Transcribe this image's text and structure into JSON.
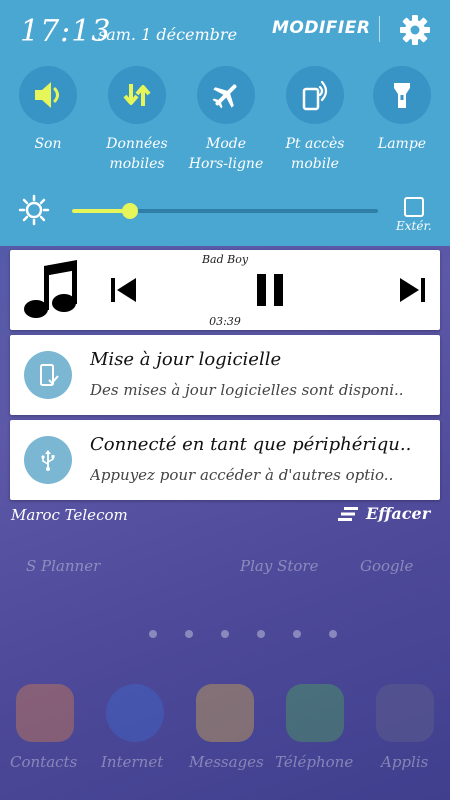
{
  "status": {
    "time": "17:13",
    "date": "sam. 1 décembre",
    "modify_label": "MODIFIER"
  },
  "quick_settings": [
    {
      "label_line1": "Son",
      "label_line2": "",
      "icon": "speaker-icon",
      "active": true
    },
    {
      "label_line1": "Données",
      "label_line2": "mobiles",
      "icon": "data-arrows-icon",
      "active": true
    },
    {
      "label_line1": "Mode",
      "label_line2": "Hors-ligne",
      "icon": "airplane-icon",
      "active": false
    },
    {
      "label_line1": "Pt accès",
      "label_line2": "mobile",
      "icon": "hotspot-icon",
      "active": false
    },
    {
      "label_line1": "Lampe",
      "label_line2": "",
      "icon": "flashlight-icon",
      "active": false
    }
  ],
  "brightness": {
    "level": 0.19,
    "auto_label": "Extér."
  },
  "music": {
    "title": "Bad Boy",
    "time": "03:39"
  },
  "notifications": [
    {
      "title": "Mise à jour logicielle",
      "text": "Des mises à jour logicielles sont disponi..",
      "icon": "phone-update-icon"
    },
    {
      "title": "Connecté en tant que périphériqu..",
      "text": "Appuyez pour accéder à d'autres optio..",
      "icon": "usb-icon"
    }
  ],
  "footer": {
    "carrier": "Maroc Telecom",
    "clear_label": "Effacer"
  },
  "home": {
    "row_labels": [
      "S Planner",
      "Play Store",
      "Google"
    ],
    "dock_labels": [
      "Contacts",
      "Internet",
      "Messages",
      "Téléphone",
      "Applis"
    ]
  },
  "colors": {
    "panel": "#4aa7d2",
    "active_icon": "#e6f55a",
    "icon_circle": "#3794c4"
  }
}
